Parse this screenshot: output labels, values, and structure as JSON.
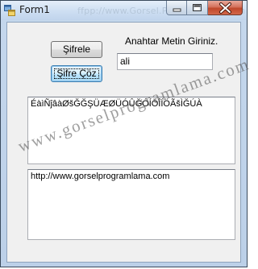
{
  "window": {
    "title": "Form1",
    "title_watermark": "ffpp://www.Gorsel.Programlama.com",
    "caption_buttons": [
      "minimize",
      "maximize",
      "close"
    ]
  },
  "form": {
    "encrypt_button": "Şifrele",
    "decrypt_button": "Şifre Çöz",
    "prompt_label": "Anahtar Metin Giriniz.",
    "key_input_value": "ali",
    "output_text": "ÉàìÑĵâàØšĞĞŞÜÆØÜÓÛĞÓÍÖÎÍÖÃšÌĞÚÀ",
    "input_text": "http://www.gorselprogramlama.com"
  },
  "watermark": {
    "text": "www.gorselprogramlama.com"
  },
  "colors": {
    "title_bar": "#cfe0f3",
    "client_bg": "#f0f0f0",
    "close_button": "#c0482b"
  },
  "icons": {
    "app": "form-app-icon",
    "minimize": "minimize-icon",
    "maximize": "maximize-icon",
    "close": "close-icon"
  }
}
